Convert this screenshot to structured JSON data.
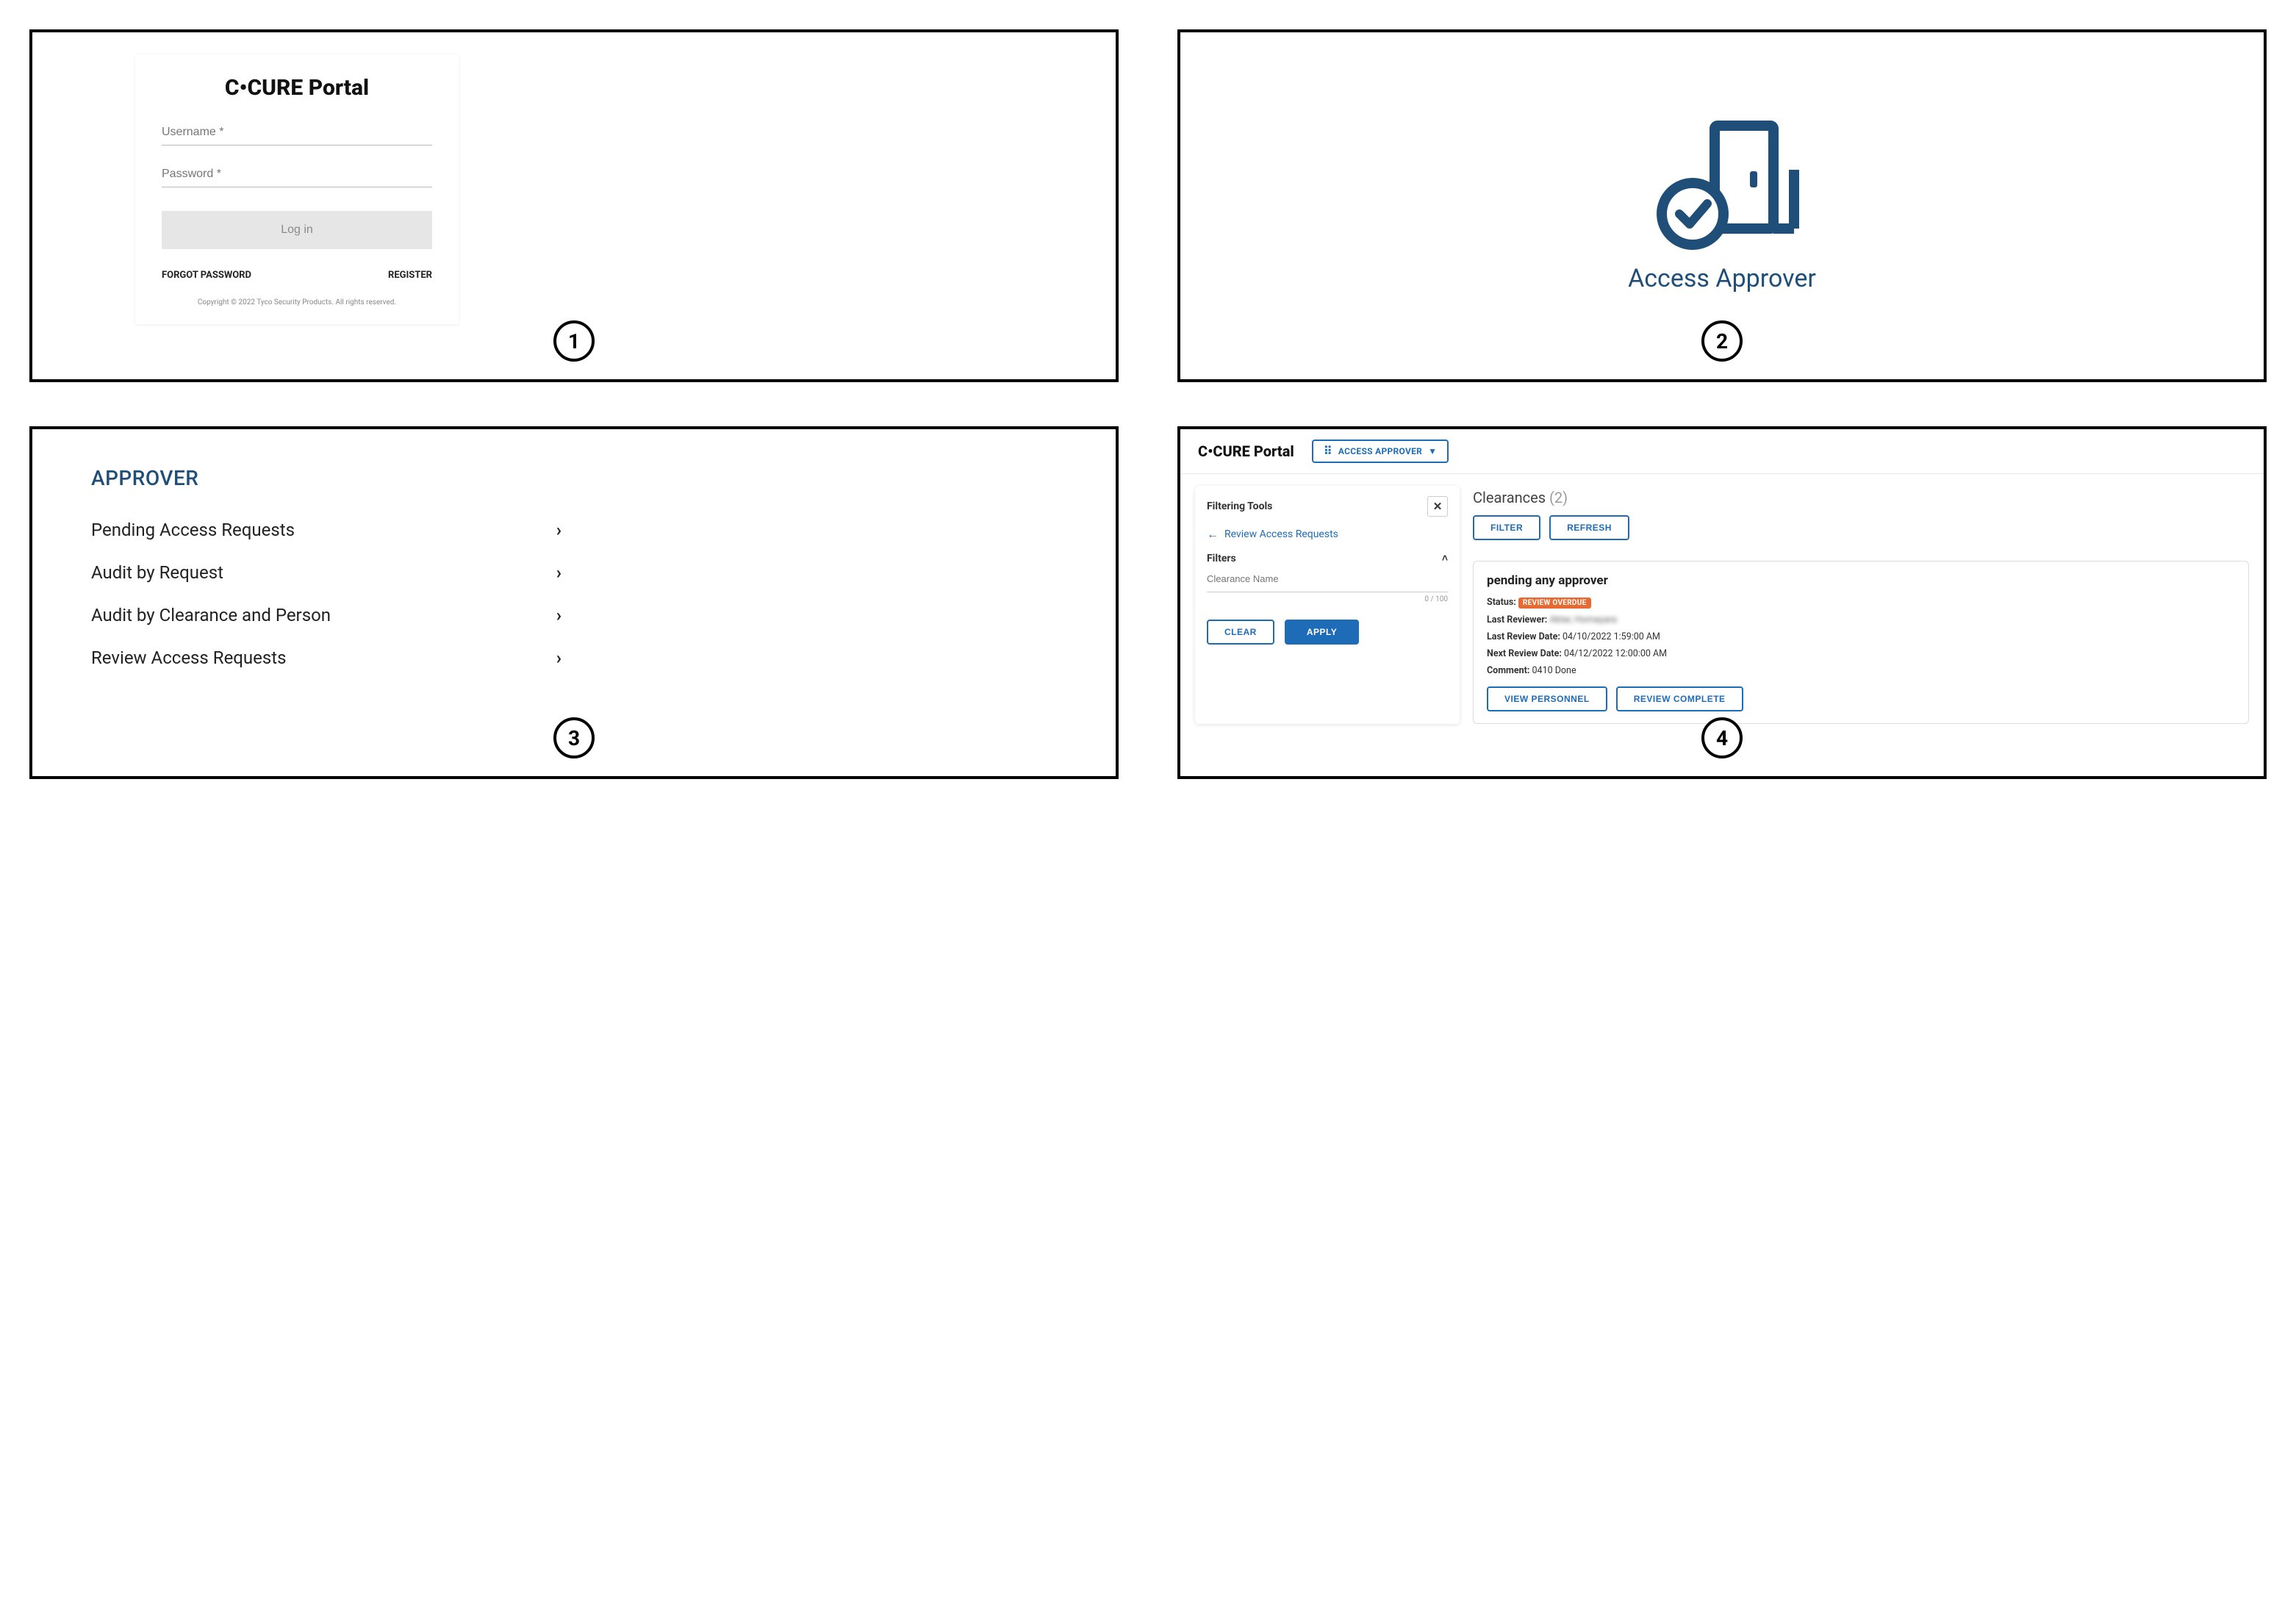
{
  "step_labels": [
    "1",
    "2",
    "3",
    "4"
  ],
  "panel1": {
    "title": "C•CURE Portal",
    "username_placeholder": "Username *",
    "password_placeholder": "Password *",
    "login_label": "Log in",
    "forgot_label": "FORGOT PASSWORD",
    "register_label": "REGISTER",
    "copyright": "Copyright © 2022 Tyco Security Products. All rights reserved."
  },
  "panel2": {
    "label": "Access Approver"
  },
  "panel3": {
    "title": "APPROVER",
    "items": [
      {
        "label": "Pending Access Requests"
      },
      {
        "label": "Audit by Request"
      },
      {
        "label": "Audit by Clearance and Person"
      },
      {
        "label": "Review Access Requests"
      }
    ]
  },
  "panel4": {
    "brand": "C•CURE Portal",
    "mode_label": "ACCESS APPROVER",
    "filter": {
      "title": "Filtering Tools",
      "crumb": "Review Access Requests",
      "section": "Filters",
      "input_placeholder": "Clearance Name",
      "counter": "0 / 100",
      "clear_label": "CLEAR",
      "apply_label": "APPLY"
    },
    "main": {
      "heading": "Clearances",
      "count": "(2)",
      "filter_btn": "FILTER",
      "refresh_btn": "REFRESH",
      "card": {
        "title": "pending any approver",
        "status_label": "Status:",
        "status_value": "REVIEW OVERDUE",
        "reviewer_label": "Last Reviewer:",
        "reviewer_value": "Akter, Homayara",
        "last_review_label": "Last Review Date:",
        "last_review_value": "04/10/2022 1:59:00 AM",
        "next_review_label": "Next Review Date:",
        "next_review_value": "04/12/2022 12:00:00 AM",
        "comment_label": "Comment:",
        "comment_value": "0410 Done",
        "view_btn": "VIEW PERSONNEL",
        "complete_btn": "REVIEW COMPLETE"
      }
    }
  }
}
